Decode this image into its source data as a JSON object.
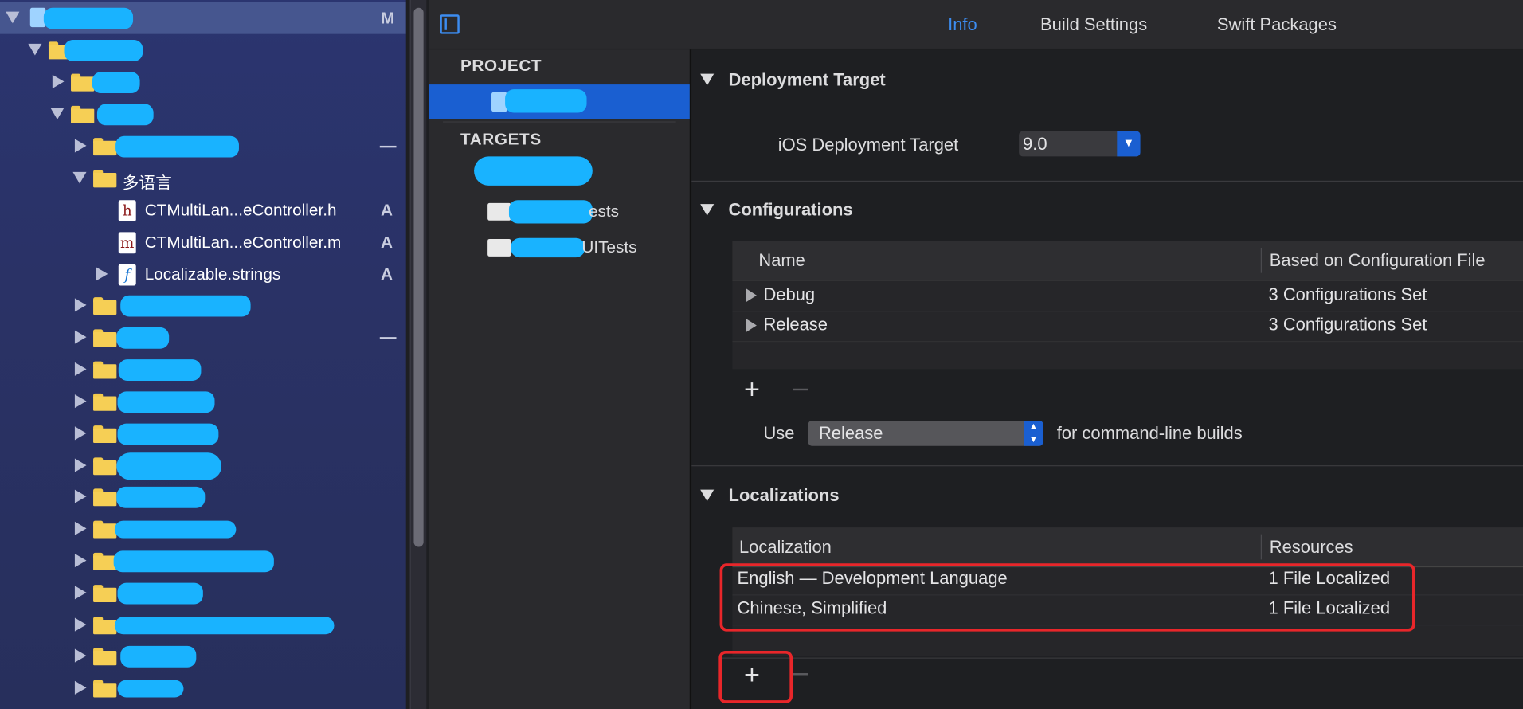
{
  "navigator": {
    "root_badge": "M",
    "localization_folder": "多语言",
    "files": [
      {
        "icon": "h",
        "name": "CTMultiLan...eController.h",
        "badge": "A"
      },
      {
        "icon": "m",
        "name": "CTMultiLan...eController.m",
        "badge": "A"
      },
      {
        "icon": "strings-icon",
        "name": "Localizable.strings",
        "badge": "A"
      }
    ]
  },
  "tabs": {
    "info": "Info",
    "build_settings": "Build Settings",
    "swift_packages": "Swift Packages"
  },
  "outline": {
    "project_header": "PROJECT",
    "targets_header": "TARGETS",
    "targets": [
      {
        "suffix": "ests"
      },
      {
        "suffix": "UITests"
      }
    ]
  },
  "deployment": {
    "header": "Deployment Target",
    "label": "iOS Deployment Target",
    "value": "9.0"
  },
  "configurations": {
    "header": "Configurations",
    "columns": [
      "Name",
      "Based on Configuration File"
    ],
    "rows": [
      {
        "name": "Debug",
        "file": "3 Configurations Set"
      },
      {
        "name": "Release",
        "file": "3 Configurations Set"
      }
    ],
    "use_label": "Use",
    "use_value": "Release",
    "use_suffix": "for command-line builds"
  },
  "localizations": {
    "header": "Localizations",
    "columns": [
      "Localization",
      "Resources"
    ],
    "rows": [
      {
        "name": "English — Development Language",
        "resources": "1 File Localized"
      },
      {
        "name": "Chinese, Simplified",
        "resources": "1 File Localized"
      }
    ]
  },
  "colors": {
    "accent": "#3c8cf0",
    "selection": "#1a5fd1",
    "highlight": "#e8262a",
    "redaction": "#19b3ff"
  }
}
